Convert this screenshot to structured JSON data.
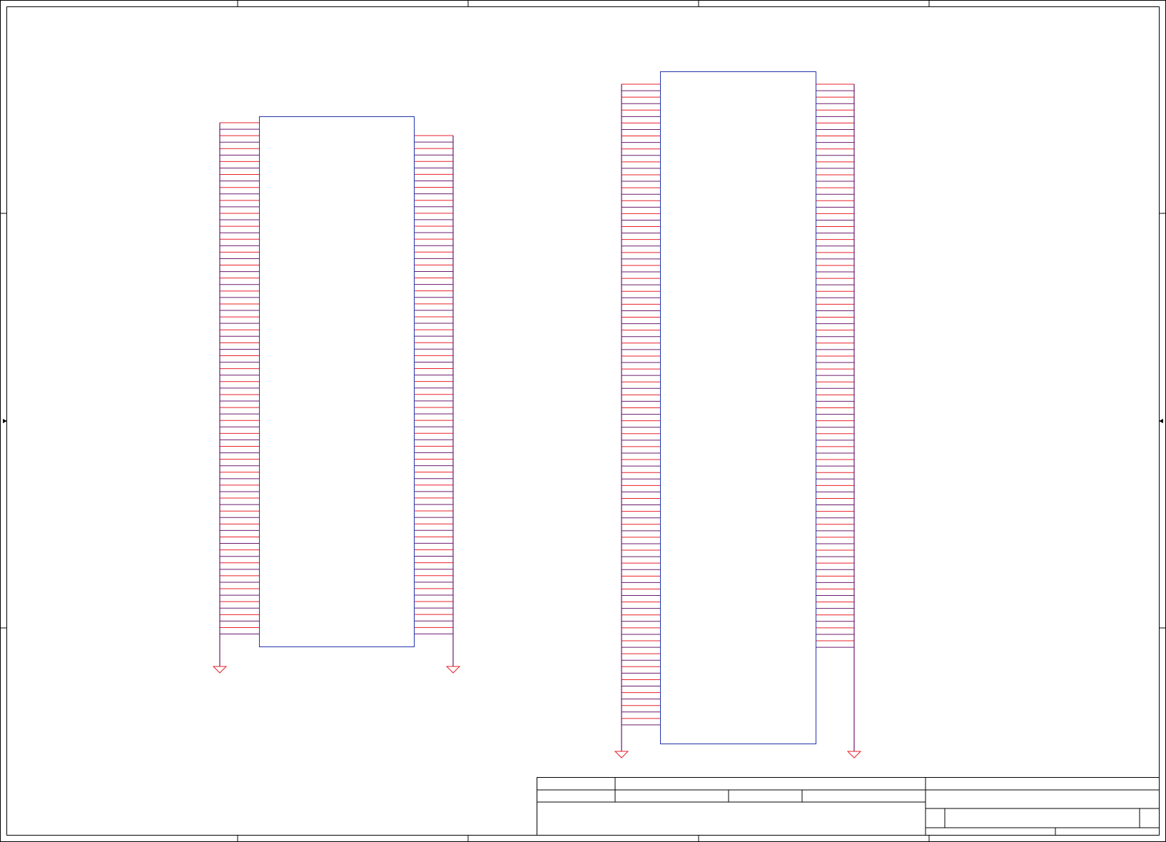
{
  "sheet": {
    "background": "#ffffff",
    "frame_color": "#000000",
    "symbol_color": "#2233aa",
    "wire_color": "#e8202a",
    "junction_color": "#6b1a6b",
    "ground_color": "#e8202a"
  },
  "components": [
    {
      "id": "u1",
      "left_pin_count": 80,
      "right_pin_count": 78
    },
    {
      "id": "u2",
      "left_pin_count": 100,
      "right_pin_count": 88
    }
  ],
  "title_block": {
    "visible_text": []
  }
}
